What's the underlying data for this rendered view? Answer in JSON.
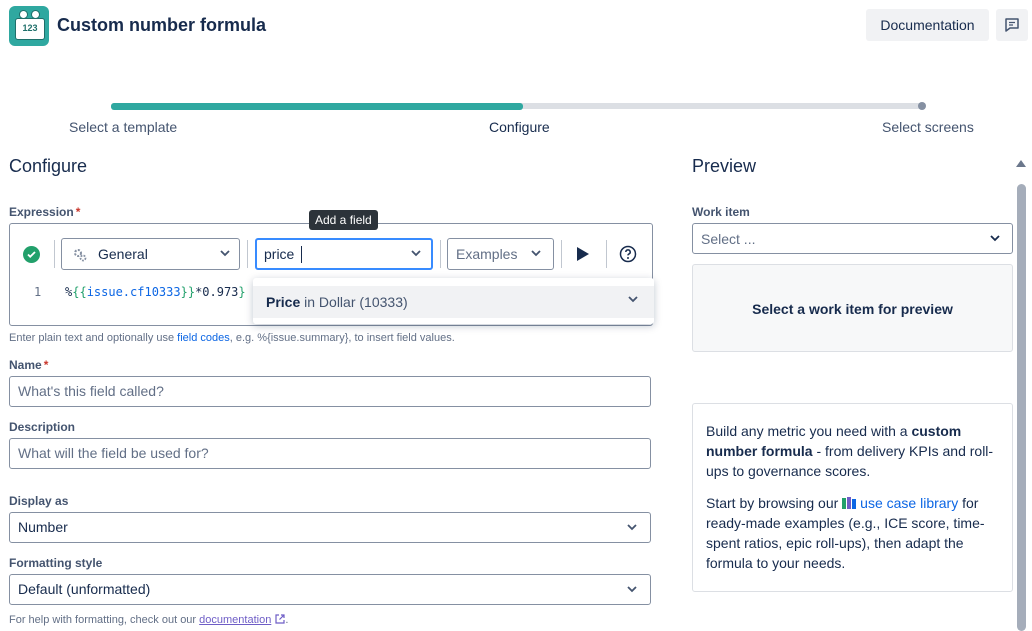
{
  "header": {
    "title": "Custom number formula",
    "logo_text": "123",
    "documentation_label": "Documentation"
  },
  "progress": {
    "fraction": 0.5,
    "steps": [
      "Select a template",
      "Configure",
      "Select screens"
    ]
  },
  "configure": {
    "heading": "Configure",
    "expression": {
      "label": "Expression",
      "required_mark": "*",
      "category_select": "General",
      "search_value": "price",
      "examples_placeholder": "Examples",
      "tooltip": "Add a field",
      "line_number": "1",
      "code": {
        "prefix": "%",
        "open": "{{",
        "field": "issue.cf10333",
        "close": "}}",
        "suffix": "*0.973",
        "end": "}"
      },
      "suggestion": {
        "field_name": "Price",
        "detail": " in Dollar (10333)"
      },
      "helper_pre": "Enter plain text and optionally use ",
      "helper_link": "field codes",
      "helper_post": ", e.g. %{issue.summary}, to insert field values."
    },
    "name": {
      "label": "Name",
      "required_mark": "*",
      "placeholder": "What's this field called?"
    },
    "description": {
      "label": "Description",
      "placeholder": "What will the field be used for?"
    },
    "display_as": {
      "label": "Display as",
      "value": "Number"
    },
    "formatting": {
      "label": "Formatting style",
      "value": "Default (unformatted)",
      "helper_pre": "For help with formatting, check out our ",
      "helper_link": "documentation",
      "helper_post": "."
    }
  },
  "preview": {
    "heading": "Preview",
    "work_item_label": "Work item",
    "work_item_placeholder": "Select ...",
    "empty_text": "Select a work item for preview",
    "info": {
      "p1_pre": "Build any metric you need with a ",
      "p1_bold": "custom number formula",
      "p1_post": " - from delivery KPIs and roll-ups to governance scores.",
      "p2_pre": "Start by browsing our ",
      "p2_link": "use case library",
      "p2_post": " for ready-made examples (e.g., ICE score, time-spent ratios, epic roll-ups), then adapt the formula to your needs."
    }
  },
  "colors": {
    "accent": "#2fa8a0",
    "focus": "#388bff",
    "link": "#0c66e4",
    "success": "#22a06b",
    "required": "#c9372c"
  }
}
